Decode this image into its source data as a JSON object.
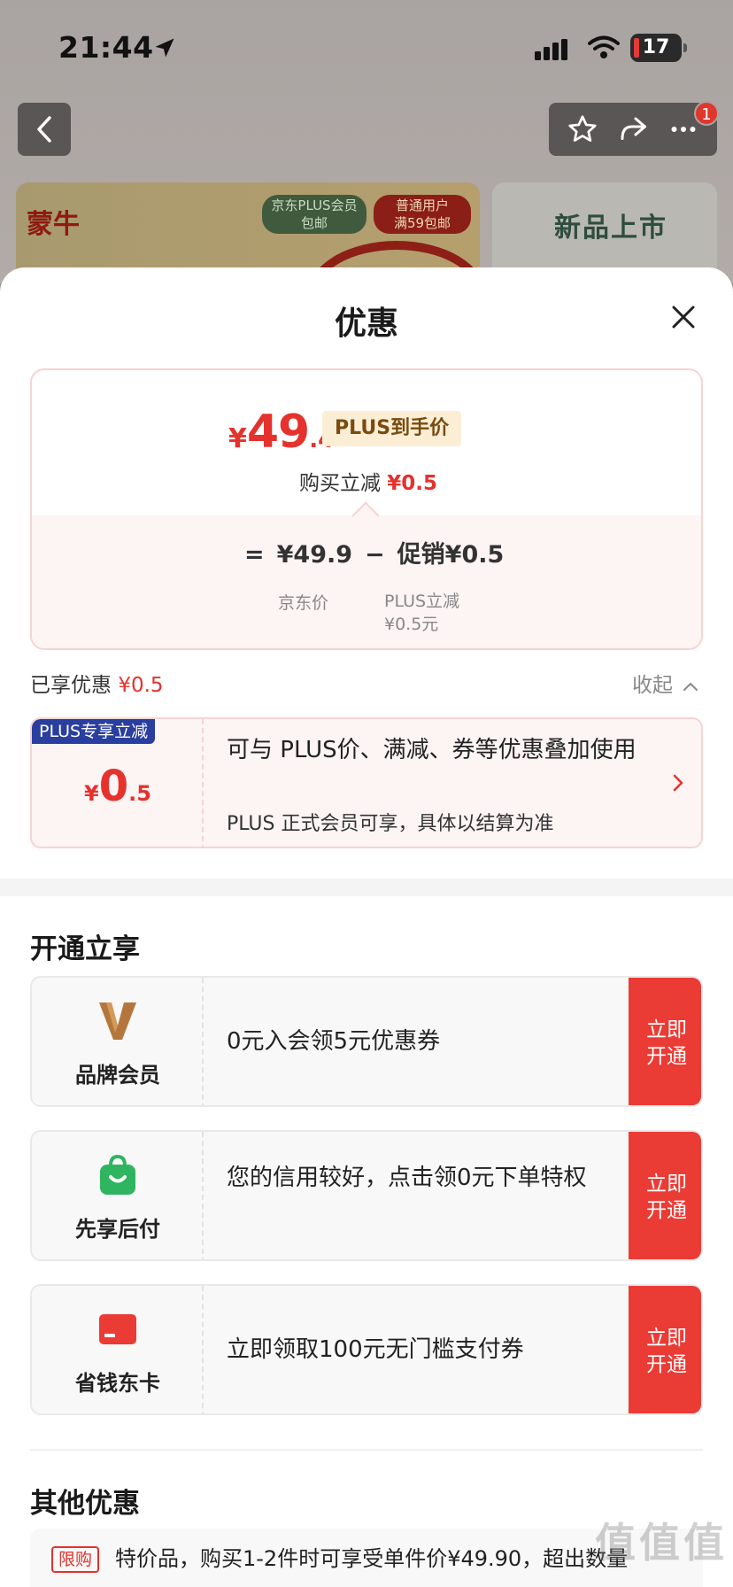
{
  "status_bar": {
    "time": "21:44",
    "battery": "17"
  },
  "nav": {
    "badge_count": "1"
  },
  "background_banners": {
    "left_brand": "蒙牛",
    "left_tag1_line1": "京东PLUS会员",
    "left_tag1_line2": "包邮",
    "left_tag2_line1": "普通用户",
    "left_tag2_line2": "满59包邮",
    "right_text": "新品上市"
  },
  "sheet": {
    "title": "优惠",
    "price_card": {
      "currency": "¥",
      "price_int": "49",
      "price_dec": ".4",
      "plus_tag": "PLUS到手价",
      "reduce_label": "购买立减",
      "reduce_value": "¥0.5",
      "calc_eq": "=",
      "calc_base": "¥49.9",
      "calc_minus": "−",
      "calc_promo": "促销¥0.5",
      "base_label": "京东价",
      "promo_label_line1": "PLUS立减",
      "promo_label_line2": "¥0.5元"
    },
    "enjoyed": {
      "label": "已享优惠",
      "value": "¥0.5",
      "collapse_label": "收起"
    },
    "plus_offer": {
      "tag": "PLUS专享立减",
      "amount_symbol": "¥",
      "amount_int": "0",
      "amount_dec": ".5",
      "desc": "可与 PLUS价、满减、券等优惠叠加使用",
      "note": "PLUS 正式会员可享，具体以结算为准"
    },
    "open_section": {
      "title": "开通立享",
      "items": [
        {
          "name": "品牌会员",
          "desc": "0元入会领5元优惠券",
          "button": "立即开通"
        },
        {
          "name": "先享后付",
          "desc": "您的信用较好，点击领0元下单特权",
          "button": "立即开通"
        },
        {
          "name": "省钱东卡",
          "desc": "立即领取100元无门槛支付券",
          "button": "立即开通"
        }
      ]
    },
    "other_section": {
      "title": "其他优惠",
      "tag": "限购",
      "text": "特价品，购买1-2件时可享受单件价¥49.90，超出数量"
    }
  },
  "watermark": "值值值",
  "colors": {
    "accent_red": "#e5322d",
    "plus_blue": "#2a3ea0",
    "button_red": "#ea3b35"
  }
}
